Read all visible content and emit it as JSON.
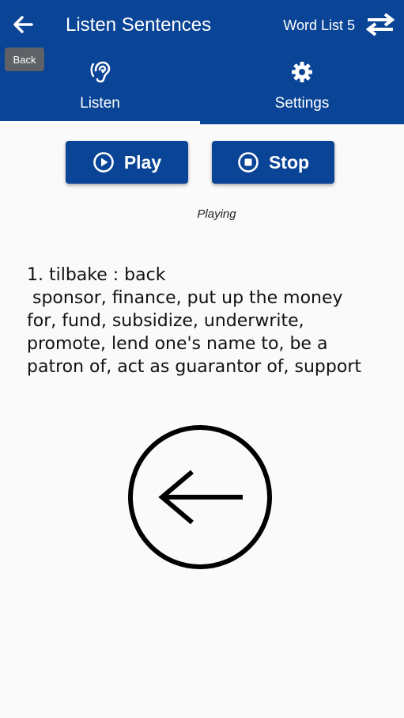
{
  "header": {
    "back_tooltip": "Back",
    "title": "Listen Sentences",
    "word_list": "Word List 5"
  },
  "tabs": [
    {
      "label": "Listen",
      "icon": "hearing-icon",
      "active": true
    },
    {
      "label": "Settings",
      "icon": "gear-icon",
      "active": false
    }
  ],
  "controls": {
    "play_label": "Play",
    "stop_label": "Stop",
    "status": "Playing"
  },
  "sentence": {
    "heading": "1. tilbake : back",
    "lines": [
      " sponsor, finance, put up the money",
      "for, fund, subsidize, underwrite,",
      "promote, lend one's name to, be a",
      "patron of, act as guarantor of, support"
    ]
  },
  "colors": {
    "primary": "#0a4496",
    "background": "#fafafa",
    "tooltip": "#5e6266"
  }
}
